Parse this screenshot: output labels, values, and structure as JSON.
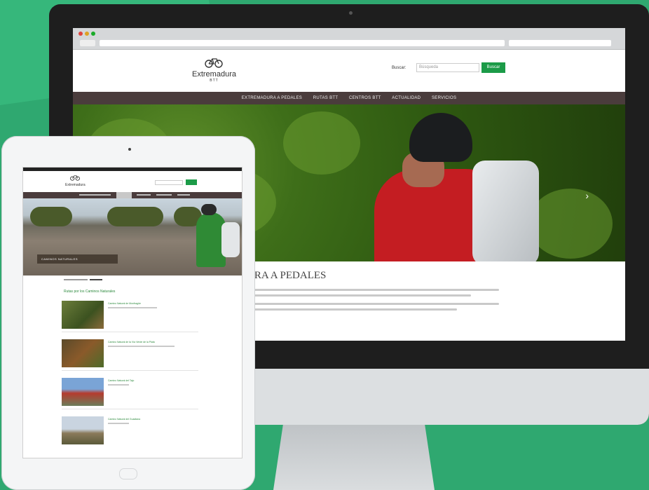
{
  "desktop": {
    "logo": {
      "name": "Extremadura",
      "sub": "BTT"
    },
    "search": {
      "label": "Buscar:",
      "placeholder": "Búsqueda",
      "button": "Buscar"
    },
    "nav": [
      "EXTREMADURA A PEDALES",
      "RUTAS BTT",
      "CENTROS BTT",
      "ACTUALIDAD",
      "SERVICIOS"
    ],
    "hero_arrow": "›",
    "intro_title": "URA A PEDALES"
  },
  "tablet": {
    "logo": {
      "name": "Extremadura"
    },
    "hero_caption": "CAMINOS NATURALES",
    "section_title": "Rutas por los Caminos Naturales",
    "routes": [
      {
        "title": "Camino Natural de Monfragüe"
      },
      {
        "title": "Camino Natural de la Vía Verde de la Plata"
      },
      {
        "title": "Camino Natural del Tajo"
      },
      {
        "title": "Camino Natural del Guadiana"
      }
    ]
  },
  "colors": {
    "background": "#2fa870",
    "accent": "#1c9b48",
    "nav": "#4a3c3c",
    "link": "#2d8a3e"
  },
  "icons": [
    "bicycle-logo-icon",
    "chevron-right-icon",
    "home-button-icon",
    "camera-icon"
  ]
}
